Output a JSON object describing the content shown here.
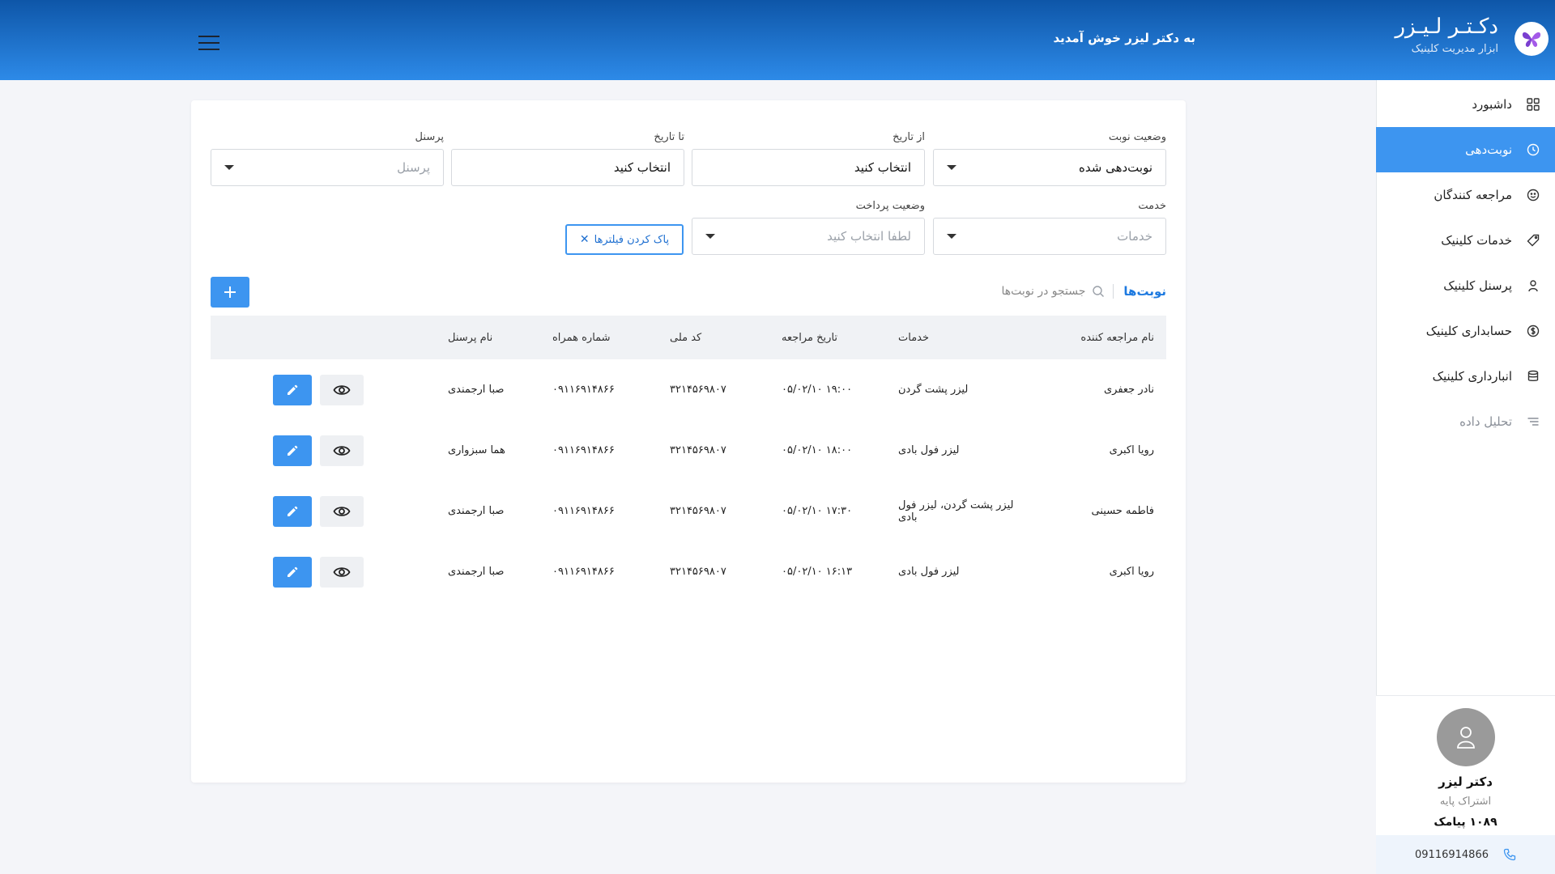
{
  "header": {
    "welcome": "به دکتر لیزر خوش آمدید"
  },
  "brand": {
    "title": "دکـتـر لـیـزر",
    "subtitle": "ابزار مدیریت کلینیک"
  },
  "sidebar": {
    "items": [
      {
        "label": "داشبورد"
      },
      {
        "label": "نوبت‌دهی"
      },
      {
        "label": "مراجعه کنندگان"
      },
      {
        "label": "خدمات کلینیک"
      },
      {
        "label": "پرسنل کلینیک"
      },
      {
        "label": "حسابداری کلینیک"
      },
      {
        "label": "انبارداری کلینیک"
      },
      {
        "label": "تحلیل داده"
      }
    ]
  },
  "profile": {
    "name": "دکتر لیزر",
    "plan": "اشتراک پایه",
    "sms": "۱۰۸۹ پیامک",
    "phone": "09116914866"
  },
  "filters": {
    "status": {
      "label": "وضعیت نوبت",
      "value": "نوبت‌دهی شده"
    },
    "from_date": {
      "label": "از تاریخ",
      "value": "انتخاب کنید"
    },
    "to_date": {
      "label": "تا تاریخ",
      "value": "انتخاب کنید"
    },
    "personnel": {
      "label": "پرسنل",
      "placeholder": "پرسنل"
    },
    "service": {
      "label": "خدمت",
      "placeholder": "خدمات"
    },
    "payment": {
      "label": "وضعیت پرداخت",
      "placeholder": "لطفا انتخاب کنید"
    },
    "clear_label": "پاک کردن فیلترها"
  },
  "list": {
    "tab": "نوبت‌ها",
    "search_placeholder": "جستجو در نوبت‌ها"
  },
  "table": {
    "headers": [
      "نام مراجعه کننده",
      "خدمات",
      "تاریخ مراجعه",
      "کد ملی",
      "شماره همراه",
      "نام پرسنل"
    ],
    "rows": [
      {
        "name": "نادر جعفری",
        "service": "لیزر پشت گردن",
        "date": "۰۵/۰۲/۱۰   ۱۹:۰۰",
        "national_id": "۳۲۱۴۵۶۹۸۰۷",
        "mobile": "۰۹۱۱۶۹۱۴۸۶۶",
        "staff": "صبا ارجمندی"
      },
      {
        "name": "رویا اکبری",
        "service": "لیزر فول بادی",
        "date": "۰۵/۰۲/۱۰   ۱۸:۰۰",
        "national_id": "۳۲۱۴۵۶۹۸۰۷",
        "mobile": "۰۹۱۱۶۹۱۴۸۶۶",
        "staff": "هما سبزواری"
      },
      {
        "name": "فاطمه حسینی",
        "service": "لیزر پشت گردن، لیزر فول بادی",
        "date": "۰۵/۰۲/۱۰   ۱۷:۳۰",
        "national_id": "۳۲۱۴۵۶۹۸۰۷",
        "mobile": "۰۹۱۱۶۹۱۴۸۶۶",
        "staff": "صبا ارجمندی"
      },
      {
        "name": "رویا اکبری",
        "service": "لیزر فول بادی",
        "date": "۰۵/۰۲/۱۰   ۱۶:۱۳",
        "national_id": "۳۲۱۴۵۶۹۸۰۷",
        "mobile": "۰۹۱۱۶۹۱۴۸۶۶",
        "staff": "صبا ارجمندی"
      }
    ]
  },
  "colors": {
    "primary": "#3d95f0",
    "header_dark": "#0e56a8",
    "active_nav": "#3d95f0"
  }
}
